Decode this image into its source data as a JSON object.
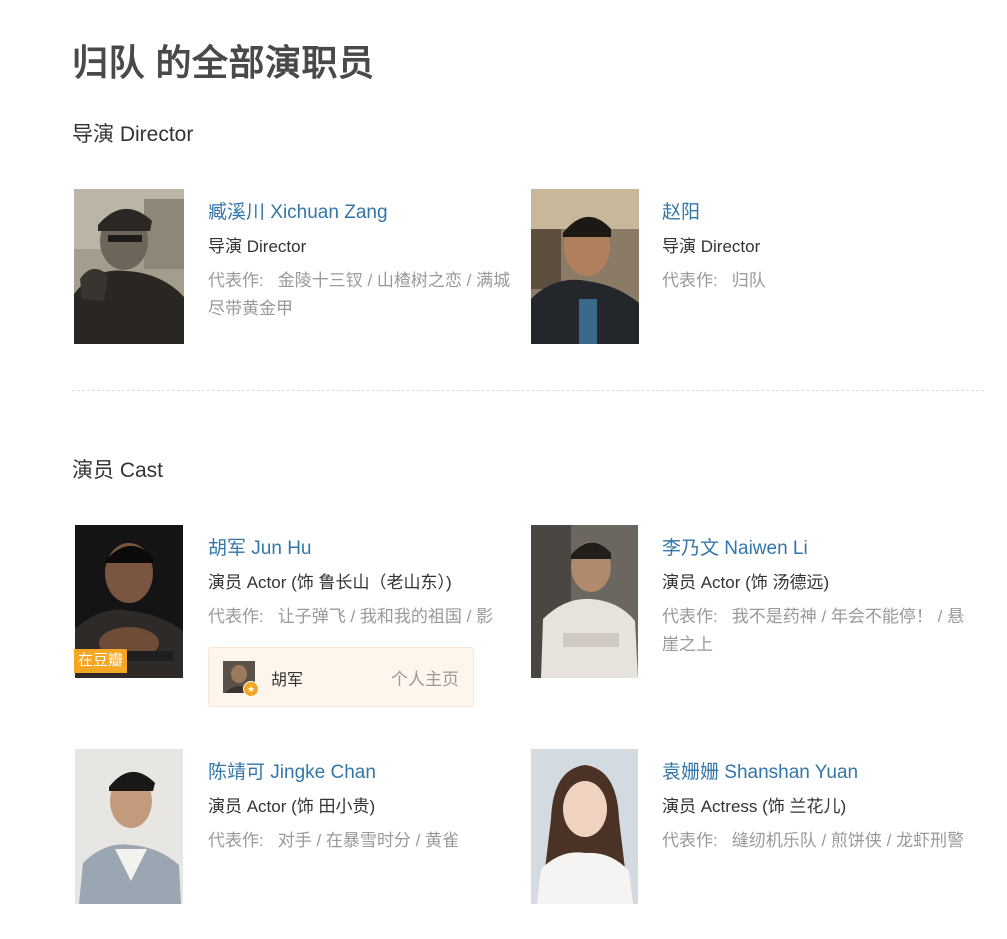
{
  "page_title": "归队 的全部演职员",
  "sections": {
    "director": {
      "title": "导演 Director",
      "people": [
        {
          "name": "臧溪川 Xichuan Zang",
          "role": "导演 Director",
          "works_prefix": "代表作:",
          "works": [
            "金陵十三钗",
            "山楂树之恋",
            "满城尽带黄金甲"
          ]
        },
        {
          "name": "赵阳",
          "role": "导演 Director",
          "works_prefix": "代表作:",
          "works": [
            "归队"
          ]
        }
      ]
    },
    "cast": {
      "title": "演员 Cast",
      "people": [
        {
          "name": "胡军 Jun Hu",
          "role": "演员 Actor (饰 鲁长山（老山东）)",
          "works_prefix": "代表作:",
          "works": [
            "让子弹飞",
            "我和我的祖国",
            "影"
          ],
          "badge": "在豆瓣",
          "homepage": {
            "name": "胡军",
            "link_label": "个人主页"
          }
        },
        {
          "name": "李乃文 Naiwen Li",
          "role": "演员 Actor (饰 汤德远)",
          "works_prefix": "代表作:",
          "works": [
            "我不是药神",
            "年会不能停！",
            "悬崖之上"
          ]
        },
        {
          "name": "陈靖可 Jingke Chan",
          "role": "演员 Actor (饰 田小贵)",
          "works_prefix": "代表作:",
          "works": [
            "对手",
            "在暴雪时分",
            "黄雀"
          ]
        },
        {
          "name": "袁姗姗 Shanshan Yuan",
          "role": "演员 Actress (饰 兰花儿)",
          "works_prefix": "代表作:",
          "works": [
            "缝纫机乐队",
            "煎饼侠",
            "龙虾刑警"
          ]
        }
      ]
    }
  },
  "colors": {
    "link": "#3377aa",
    "muted": "#999999",
    "badge": "#f5a623",
    "homepage_bg": "#fef6ed"
  }
}
